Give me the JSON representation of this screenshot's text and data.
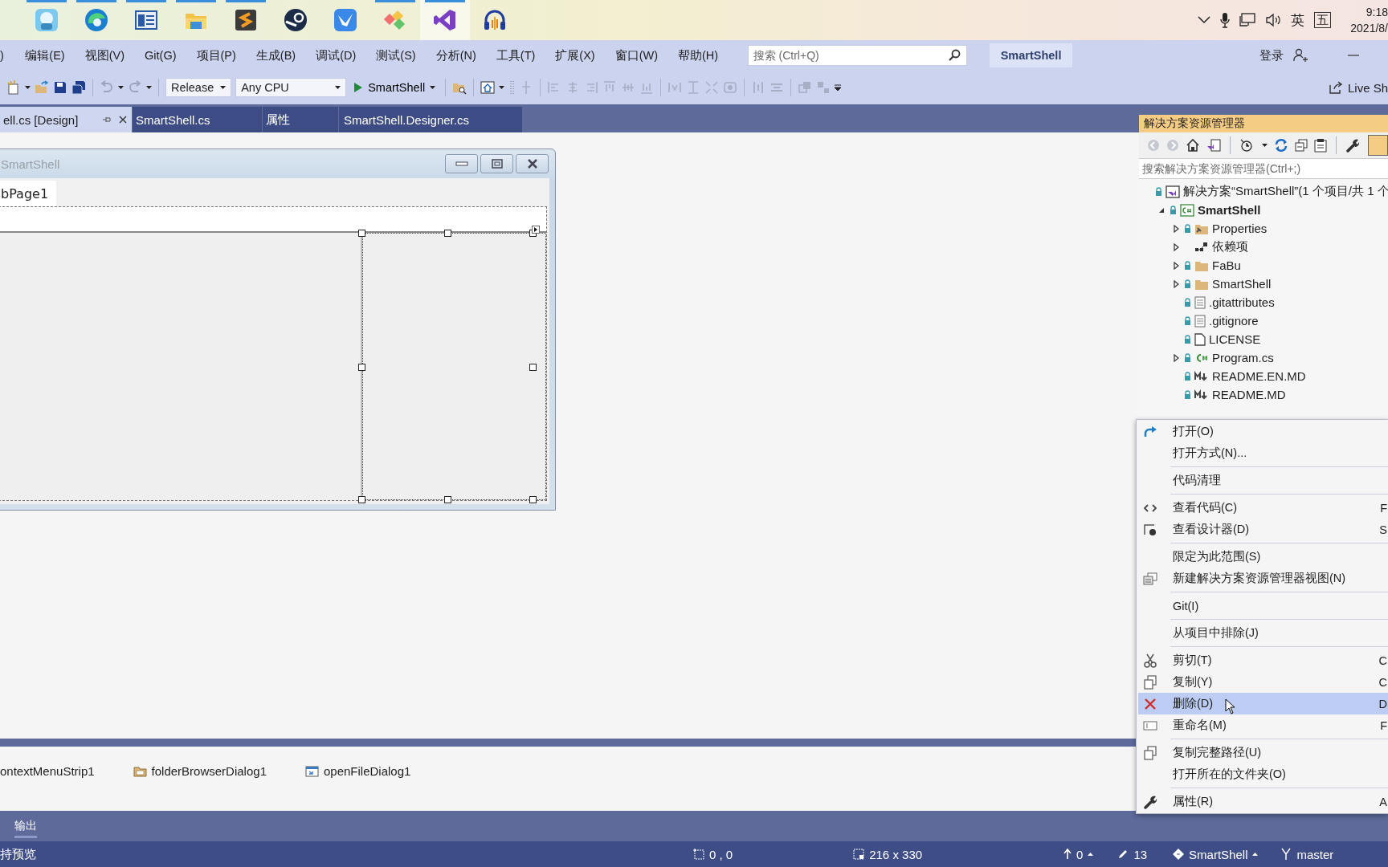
{
  "taskbar": {
    "apps": [
      {
        "running": true,
        "selected": false
      },
      {
        "running": true,
        "selected": false
      },
      {
        "running": true,
        "selected": false
      },
      {
        "running": true,
        "selected": false
      },
      {
        "running": true,
        "selected": false
      },
      {
        "running": false,
        "selected": false
      },
      {
        "running": false,
        "selected": false
      },
      {
        "running": true,
        "selected": false
      },
      {
        "running": true,
        "selected": true
      },
      {
        "running": false,
        "selected": false
      }
    ],
    "tray": {
      "input_language": "英",
      "ime_mode": "五",
      "time": "9:18",
      "date": "2021/8/"
    }
  },
  "menu_bar": {
    "items": [
      ")",
      "编辑(E)",
      "视图(V)",
      "Git(G)",
      "项目(P)",
      "生成(B)",
      "调试(D)",
      "测试(S)",
      "分析(N)",
      "工具(T)",
      "扩展(X)",
      "窗口(W)",
      "帮助(H)"
    ],
    "search": {
      "placeholder": "搜索 (Ctrl+Q)"
    },
    "solution_name": "SmartShell",
    "sign_in": "登录"
  },
  "toolbar": {
    "configuration": "Release",
    "platform": "Any CPU",
    "startup_project": "SmartShell",
    "live_share": "Live Sh"
  },
  "document_tabs": [
    {
      "label": "ell.cs [Design]",
      "selected": true
    },
    {
      "label": "SmartShell.cs",
      "selected": false
    },
    {
      "label": "属性",
      "selected": false
    },
    {
      "label": "SmartShell.Designer.cs",
      "selected": false
    }
  ],
  "designer": {
    "form_title": "SmartShell",
    "tab_page": "bPage1"
  },
  "component_tray": [
    {
      "kind": "clipped",
      "label": "ontextMenuStrip1"
    },
    {
      "kind": "folder",
      "label": "folderBrowserDialog1"
    },
    {
      "kind": "file",
      "label": "openFileDialog1"
    }
  ],
  "solution_explorer": {
    "title": "解决方案资源管理器",
    "search": {
      "placeholder": "搜索解决方案资源管理器(Ctrl+;)"
    },
    "tree": [
      {
        "label": "解决方案“SmartShell”(1 个项目/共 1 个",
        "kind": "solution",
        "locked": true,
        "children": [
          {
            "label": "SmartShell",
            "kind": "project",
            "expanded": true,
            "locked": true,
            "children": [
              {
                "label": "Properties",
                "kind": "properties",
                "expanded": false,
                "locked": true
              },
              {
                "label": "依赖项",
                "kind": "dependencies",
                "expanded": false,
                "locked": false
              },
              {
                "label": "FaBu",
                "kind": "folder",
                "expanded": false,
                "locked": true
              },
              {
                "label": "SmartShell",
                "kind": "folder",
                "expanded": false,
                "locked": true
              },
              {
                "label": ".gitattributes",
                "kind": "text",
                "locked": true
              },
              {
                "label": ".gitignore",
                "kind": "text",
                "locked": true
              },
              {
                "label": "LICENSE",
                "kind": "blank",
                "locked": true
              },
              {
                "label": "Program.cs",
                "kind": "csharp",
                "expanded": false,
                "locked": true
              },
              {
                "label": "README.EN.MD",
                "kind": "markdown",
                "locked": true
              },
              {
                "label": "README.MD",
                "kind": "markdown",
                "locked": true
              }
            ]
          }
        ]
      }
    ]
  },
  "context_menu": {
    "groups": [
      {
        "items": [
          {
            "label": "打开(O)",
            "kind": "redo",
            "selected": false
          },
          {
            "label": "打开方式(N)...",
            "kind": "plain",
            "selected": false
          }
        ]
      },
      {
        "items": [
          {
            "label": "代码清理",
            "kind": "plain",
            "selected": false
          }
        ]
      },
      {
        "items": [
          {
            "label": "查看代码(C)",
            "kind": "code",
            "shortcut": "F",
            "selected": false
          },
          {
            "label": "查看设计器(D)",
            "kind": "designer",
            "shortcut": "S",
            "selected": false
          }
        ]
      },
      {
        "items": [
          {
            "label": "限定为此范围(S)",
            "kind": "plain",
            "selected": false
          },
          {
            "label": "新建解决方案资源管理器视图(N)",
            "kind": "windows",
            "selected": false
          }
        ]
      },
      {
        "items": [
          {
            "label": "Git(I)",
            "kind": "plain",
            "selected": false
          }
        ]
      },
      {
        "items": [
          {
            "label": "从项目中排除(J)",
            "kind": "plain",
            "selected": false
          }
        ]
      },
      {
        "items": [
          {
            "label": "剪切(T)",
            "kind": "cut",
            "shortcut": "C",
            "selected": false
          },
          {
            "label": "复制(Y)",
            "kind": "copy",
            "shortcut": "C",
            "selected": false
          },
          {
            "label": "删除(D)",
            "kind": "delete",
            "shortcut": "D",
            "selected": true
          },
          {
            "label": "重命名(M)",
            "kind": "rename",
            "shortcut": "F",
            "selected": false
          }
        ]
      },
      {
        "items": [
          {
            "label": "复制完整路径(U)",
            "kind": "copy",
            "selected": false
          },
          {
            "label": "打开所在的文件夹(O)",
            "kind": "plain",
            "selected": false
          }
        ]
      },
      {
        "items": [
          {
            "label": "属性(R)",
            "kind": "wrench",
            "shortcut": "A",
            "selected": false
          }
        ]
      }
    ]
  },
  "tool_tabs": [
    "输出"
  ],
  "status_bar": {
    "message": "持预览",
    "position": "0 , 0",
    "size": "216 x 330",
    "outgoing": "0",
    "changes": "13",
    "repository": "SmartShell",
    "branch": "master"
  }
}
